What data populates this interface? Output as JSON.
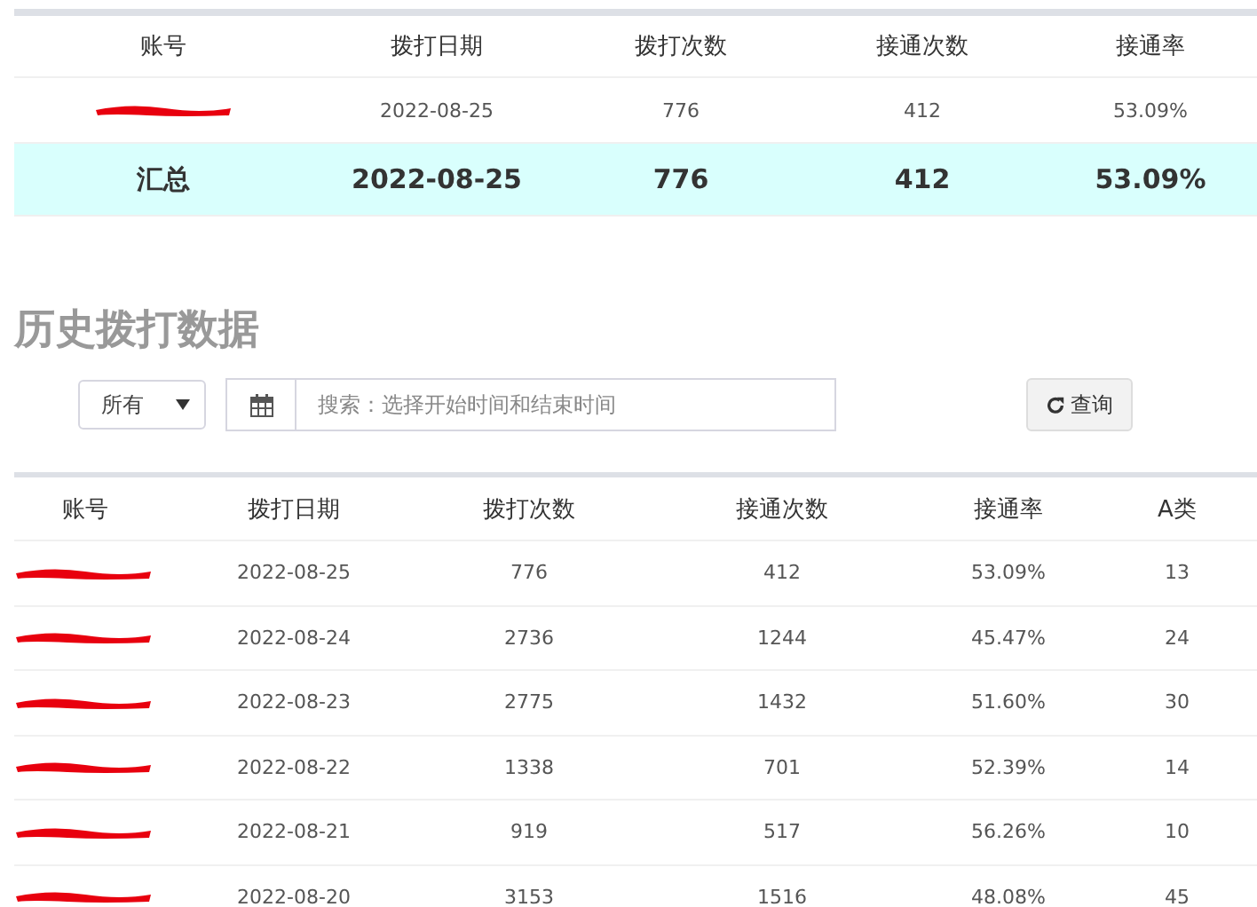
{
  "summary_table": {
    "columns": [
      "账号",
      "拨打日期",
      "拨打次数",
      "接通次数",
      "接通率"
    ],
    "rows": [
      {
        "account_redacted": true,
        "cells": [
          "",
          "2022-08-25",
          "776",
          "412",
          "53.09%"
        ]
      }
    ],
    "total": {
      "label": "汇总",
      "cells": [
        "2022-08-25",
        "776",
        "412",
        "53.09%"
      ]
    }
  },
  "history": {
    "title": "历史拨打数据",
    "filter": {
      "value": "所有"
    },
    "date_search": {
      "placeholder": "搜索：选择开始时间和结束时间"
    },
    "query_button": "查询",
    "table": {
      "columns": [
        "账号",
        "拨打日期",
        "拨打次数",
        "接通次数",
        "接通率",
        "A类"
      ],
      "rows": [
        {
          "account_redacted": true,
          "cells": [
            "",
            "2022-08-25",
            "776",
            "412",
            "53.09%",
            "13"
          ]
        },
        {
          "account_redacted": true,
          "cells": [
            "",
            "2022-08-24",
            "2736",
            "1244",
            "45.47%",
            "24"
          ]
        },
        {
          "account_redacted": true,
          "cells": [
            "",
            "2022-08-23",
            "2775",
            "1432",
            "51.60%",
            "30"
          ]
        },
        {
          "account_redacted": true,
          "cells": [
            "",
            "2022-08-22",
            "1338",
            "701",
            "52.39%",
            "14"
          ]
        },
        {
          "account_redacted": true,
          "cells": [
            "",
            "2022-08-21",
            "919",
            "517",
            "56.26%",
            "10"
          ]
        },
        {
          "account_redacted": true,
          "cells": [
            "",
            "2022-08-20",
            "3153",
            "1516",
            "48.08%",
            "45"
          ]
        }
      ]
    }
  }
}
